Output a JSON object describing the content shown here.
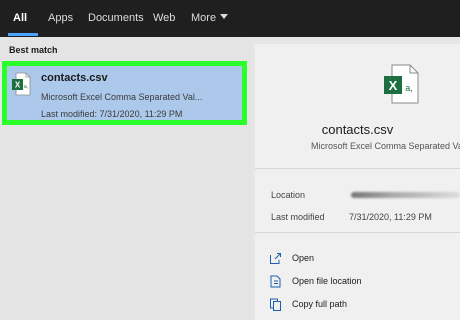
{
  "tabs": [
    {
      "label": "All"
    },
    {
      "label": "Apps"
    },
    {
      "label": "Documents"
    },
    {
      "label": "Web"
    },
    {
      "label": "More"
    }
  ],
  "left": {
    "section_label": "Best match",
    "result": {
      "name": "contacts.csv",
      "type": "Microsoft Excel Comma Separated Val...",
      "modified": "Last modified: 7/31/2020, 11:29 PM"
    }
  },
  "details": {
    "name": "contacts.csv",
    "type": "Microsoft Excel Comma Separated Va",
    "location_label": "Location",
    "modified_label": "Last modified",
    "modified_value": "7/31/2020, 11:29 PM",
    "actions": [
      {
        "label": "Open",
        "icon": "open-icon"
      },
      {
        "label": "Open file location",
        "icon": "file-location-icon"
      },
      {
        "label": "Copy full path",
        "icon": "copy-path-icon"
      }
    ]
  },
  "colors": {
    "accent": "#4aa3ff",
    "highlight_border": "#2bff2b",
    "selection": "#acc9eb",
    "excel_green": "#1d6f42"
  }
}
